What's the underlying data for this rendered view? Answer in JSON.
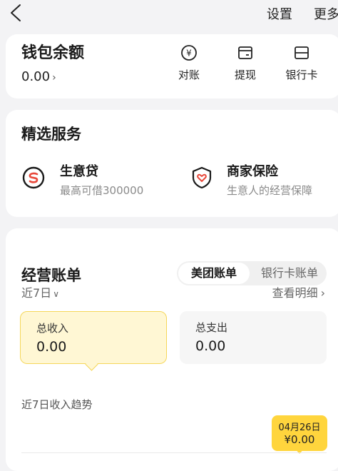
{
  "topbar": {
    "settings_label": "设置",
    "more_label": "更多"
  },
  "wallet": {
    "title": "钱包余额",
    "amount": "0.00",
    "actions": [
      {
        "label": "对账",
        "icon": "yuan-circle-icon"
      },
      {
        "label": "提现",
        "icon": "withdraw-card-icon"
      },
      {
        "label": "银行卡",
        "icon": "bank-card-icon"
      }
    ]
  },
  "services": {
    "title": "精选服务",
    "items": [
      {
        "name": "生意贷",
        "sub": "最高可借300000",
        "icon": "loan-icon",
        "color": "#e8483a"
      },
      {
        "name": "商家保险",
        "sub": "生意人的经营保障",
        "icon": "insurance-shield-icon",
        "color": "#e8483a"
      }
    ]
  },
  "bills": {
    "title": "经营账单",
    "tabs": [
      "美团账单",
      "银行卡账单"
    ],
    "period": "近7日",
    "details_link": "查看明细",
    "income_label": "总收入",
    "income_value": "0.00",
    "expense_label": "总支出",
    "expense_value": "0.00",
    "trend_title": "近7日收入趋势",
    "tooltip_date": "04月26日",
    "tooltip_value": "¥0.00"
  },
  "colors": {
    "accent": "#ffd53d",
    "income_bg": "#fff7d4",
    "service_icon": "#e8483a"
  }
}
